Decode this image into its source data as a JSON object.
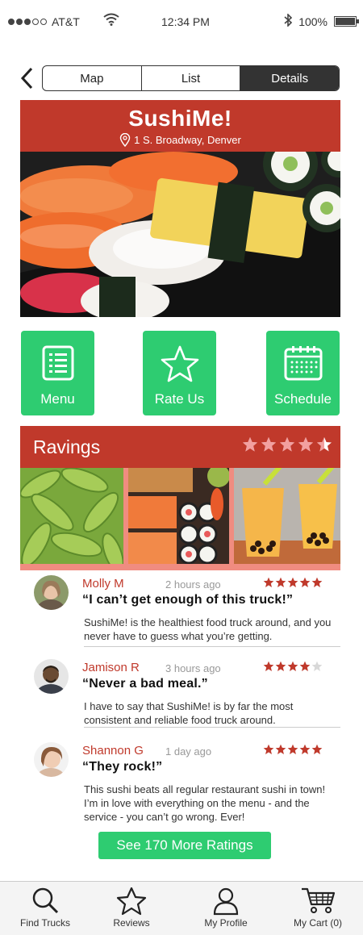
{
  "status_bar": {
    "carrier": "AT&T",
    "time": "12:34 PM",
    "battery": "100%",
    "battery_level": 1.0,
    "signal_bars_filled": 3,
    "signal_bars_total": 5
  },
  "nav": {
    "tabs": [
      {
        "label": "Map"
      },
      {
        "label": "List"
      },
      {
        "label": "Details",
        "active": true
      }
    ]
  },
  "truck": {
    "name": "SushiMe!",
    "address": "1 S. Broadway, Denver"
  },
  "actions": [
    {
      "label": "Menu",
      "icon": "menu-list-icon"
    },
    {
      "label": "Rate Us",
      "icon": "star-icon"
    },
    {
      "label": "Schedule",
      "icon": "calendar-icon"
    }
  ],
  "ratings": {
    "title": "Ravings",
    "average_stars": 4.5,
    "max_stars": 5
  },
  "reviews": [
    {
      "name": "Molly M",
      "time": "2 hours ago",
      "stars": 5,
      "quote": "“I can’t get enough of this truck!”",
      "body": "SushiMe! is the healthiest food truck around, and you never have to guess what you’re getting."
    },
    {
      "name": "Jamison R",
      "time": "3 hours ago",
      "stars": 4,
      "quote": "“Never a bad meal.”",
      "body": "I have to say that SushiMe! is by far the most consistent and reliable food truck around."
    },
    {
      "name": "Shannon G",
      "time": "1 day ago",
      "stars": 5,
      "quote": "“They rock!”",
      "body": "This sushi beats all regular restaurant sushi in town! I’m in love with everything on the menu - and the service - you can’t go wrong. Ever!"
    }
  ],
  "more_button": {
    "label": "See 170 More Ratings"
  },
  "tab_bar": {
    "items": [
      {
        "label": "Find Trucks",
        "icon": "search-icon"
      },
      {
        "label": "Reviews",
        "icon": "star-outline-icon"
      },
      {
        "label": "My Profile",
        "icon": "user-icon"
      },
      {
        "label": "My Cart (0)",
        "icon": "cart-icon"
      }
    ]
  },
  "colors": {
    "brand_red": "#c0392b",
    "accent_green": "#2ecc71",
    "star_pink": "#f2a0a0",
    "dark": "#333333"
  }
}
